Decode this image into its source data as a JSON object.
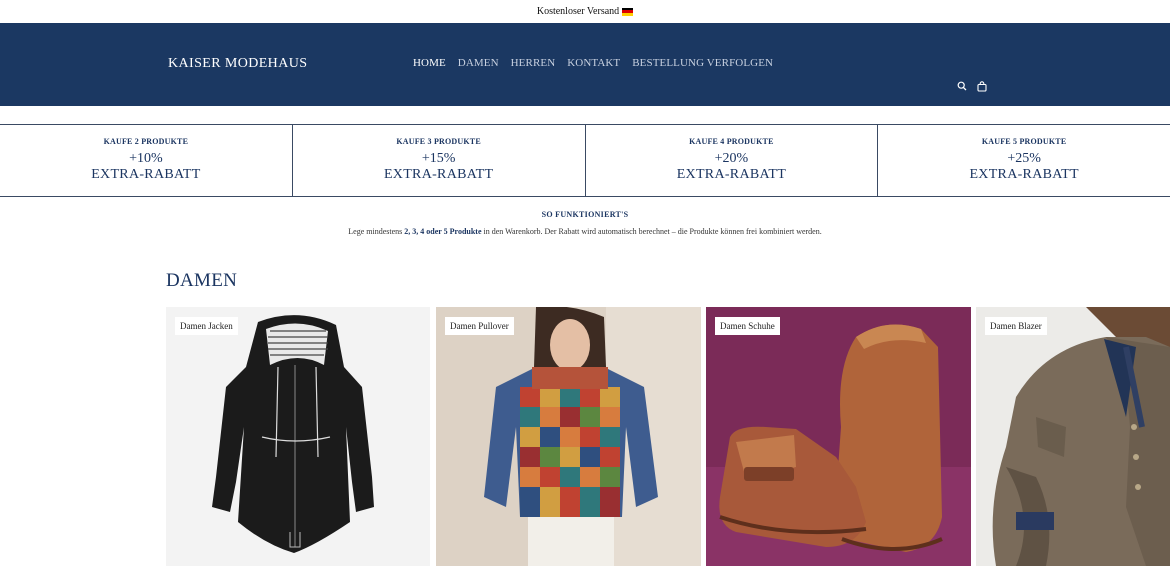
{
  "announcement": {
    "text": "Kostenloser Versand",
    "flag": "german-flag-icon"
  },
  "header": {
    "logo": "KAISER MODEHAUS",
    "nav": [
      {
        "label": "HOME",
        "active": true
      },
      {
        "label": "DAMEN",
        "active": false
      },
      {
        "label": "HERREN",
        "active": false
      },
      {
        "label": "KONTAKT",
        "active": false
      },
      {
        "label": "BESTELLUNG VERFOLGEN",
        "active": false
      }
    ],
    "icons": [
      "search-icon",
      "cart-icon"
    ],
    "background": "#1b3862"
  },
  "promos": [
    {
      "title": "KAUFE 2 PRODUKTE",
      "percent": "+10%",
      "label": "EXTRA-RABATT"
    },
    {
      "title": "KAUFE 3 PRODUKTE",
      "percent": "+15%",
      "label": "EXTRA-RABATT"
    },
    {
      "title": "KAUFE 4 PRODUKTE",
      "percent": "+20%",
      "label": "EXTRA-RABATT"
    },
    {
      "title": "KAUFE 5 PRODUKTE",
      "percent": "+25%",
      "label": "EXTRA-RABATT"
    }
  ],
  "how_it_works": {
    "heading": "SO FUNKTIONIERT'S",
    "text_before": "Lege mindestens ",
    "text_bold": "2, 3, 4 oder 5 Produkte",
    "text_after": " in den Warenkorb. Der Rabatt wird automatisch berechnet – die Produkte können frei kombiniert werden."
  },
  "section": {
    "title": "DAMEN"
  },
  "categories": [
    {
      "label": "Damen Jacken",
      "image": "black-rain-jacket"
    },
    {
      "label": "Damen Pullover",
      "image": "checkered-sweater"
    },
    {
      "label": "Damen Schuhe",
      "image": "brown-leather-boots"
    },
    {
      "label": "Damen Blazer",
      "image": "tweed-blazer"
    }
  ]
}
